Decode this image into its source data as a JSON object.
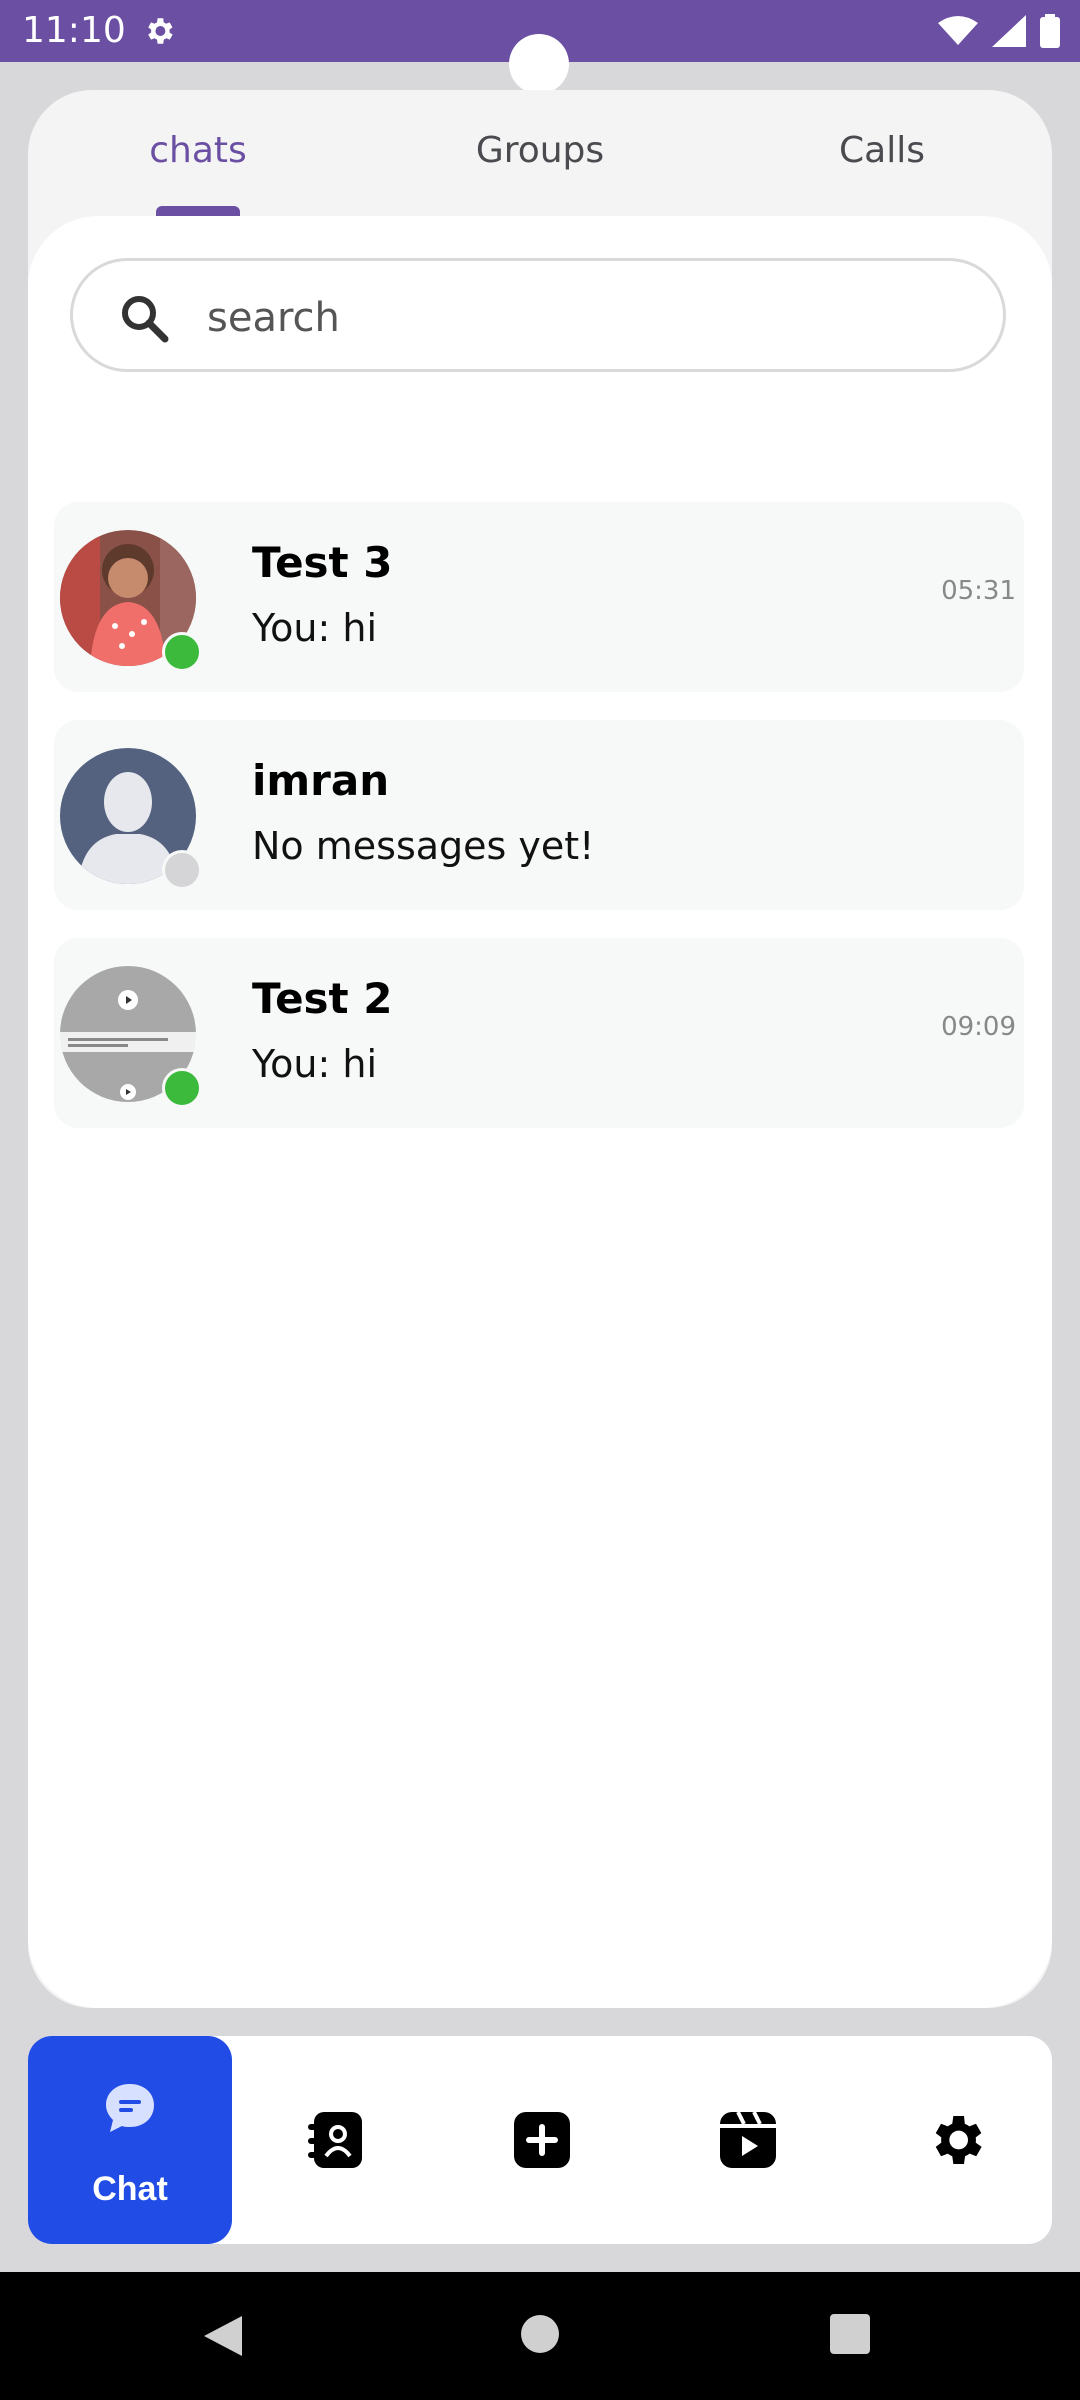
{
  "status_bar": {
    "time": "11:10"
  },
  "tabs": [
    {
      "label": "chats",
      "active": true
    },
    {
      "label": "Groups",
      "active": false
    },
    {
      "label": "Calls",
      "active": false
    }
  ],
  "search": {
    "placeholder": "search"
  },
  "chats": [
    {
      "name": "Test 3",
      "preview": "You: hi",
      "time": "05:31",
      "online": true
    },
    {
      "name": "imran",
      "preview": "No messages yet!",
      "time": "",
      "online": false
    },
    {
      "name": "Test 2",
      "preview": "You: hi",
      "time": "09:09",
      "online": true
    }
  ],
  "bottom_nav": {
    "active_label": "Chat",
    "items": [
      "chat-icon",
      "contacts-icon",
      "add-icon",
      "reels-icon",
      "settings-icon"
    ]
  },
  "colors": {
    "status_bar": "#6a4fa3",
    "accent": "#6a4fa3",
    "nav_active": "#214ce6",
    "online": "#3cba3c",
    "offline": "#d5d5d8"
  }
}
